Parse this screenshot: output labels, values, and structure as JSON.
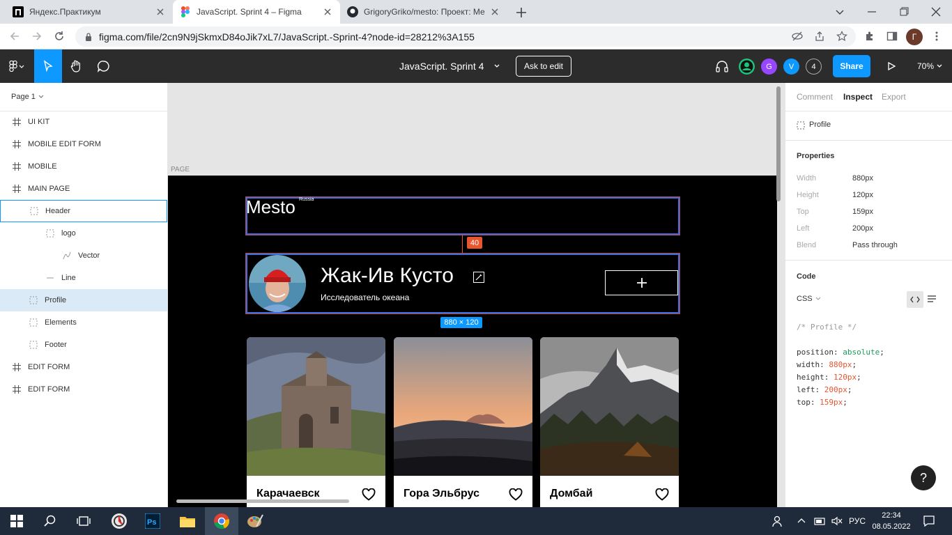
{
  "browser": {
    "tabs": [
      {
        "title": "Яндекс.Практикум",
        "active": false
      },
      {
        "title": "JavaScript. Sprint 4 – Figma",
        "active": true
      },
      {
        "title": "GrigoryGriko/mesto: Проект: Ме",
        "active": false
      }
    ],
    "url": "figma.com/file/2cn9N9jSkmxD84oJik7xL7/JavaScript.-Sprint-4?node-id=28212%3A155",
    "profile_initial": "Г"
  },
  "toolbar": {
    "file_title": "JavaScript. Sprint 4",
    "ask_to_edit": "Ask to edit",
    "avatars": [
      {
        "label": "",
        "color": "#1bc47d"
      },
      {
        "label": "G",
        "color": "#9747ff"
      },
      {
        "label": "V",
        "color": "#0d99ff"
      }
    ],
    "viewer_count": "4",
    "share": "Share",
    "zoom": "70%"
  },
  "layers": {
    "page": "Page 1",
    "items": [
      {
        "name": "UI KIT",
        "icon": "frame-icon",
        "indent": 0
      },
      {
        "name": "MOBILE EDIT FORM",
        "icon": "frame-icon",
        "indent": 0
      },
      {
        "name": "MOBILE",
        "icon": "frame-icon",
        "indent": 0
      },
      {
        "name": "MAIN PAGE",
        "icon": "frame-icon",
        "indent": 0
      },
      {
        "name": "Header",
        "icon": "group-icon",
        "indent": 1,
        "state": "hover"
      },
      {
        "name": "logo",
        "icon": "group-icon",
        "indent": 2
      },
      {
        "name": "Vector",
        "icon": "vector-icon",
        "indent": 3
      },
      {
        "name": "Line",
        "icon": "line-icon",
        "indent": 2
      },
      {
        "name": "Profile",
        "icon": "group-icon",
        "indent": 1,
        "state": "selected"
      },
      {
        "name": "Elements",
        "icon": "group-icon",
        "indent": 1
      },
      {
        "name": "Footer",
        "icon": "group-icon",
        "indent": 1
      },
      {
        "name": "EDIT FORM",
        "icon": "frame-icon",
        "indent": 0
      },
      {
        "name": "EDIT FORM",
        "icon": "frame-icon",
        "indent": 0
      }
    ]
  },
  "canvas": {
    "page_label": "PAGE",
    "logo": "Mesto",
    "logo_sub": "Russia",
    "spacing_badge": "40",
    "profile_name": "Жак-Ив Кусто",
    "profile_about": "Исследователь океана",
    "size_badge": "880 × 120",
    "cards": [
      {
        "title": "Карачаевск"
      },
      {
        "title": "Гора Эльбрус"
      },
      {
        "title": "Домбай"
      }
    ]
  },
  "inspect": {
    "tabs": [
      "Comment",
      "Inspect",
      "Export"
    ],
    "active_tab": "Inspect",
    "layer_name": "Profile",
    "properties_title": "Properties",
    "properties": [
      {
        "key": "Width",
        "value": "880px"
      },
      {
        "key": "Height",
        "value": "120px"
      },
      {
        "key": "Top",
        "value": "159px"
      },
      {
        "key": "Left",
        "value": "200px"
      },
      {
        "key": "Blend",
        "value": "Pass through"
      }
    ],
    "code_title": "Code",
    "code_lang": "CSS",
    "code_comment": "/* Profile */",
    "code_lines": [
      {
        "prop": "position",
        "val": "absolute"
      },
      {
        "prop": "width",
        "val": "880px"
      },
      {
        "prop": "height",
        "val": "120px"
      },
      {
        "prop": "left",
        "val": "200px"
      },
      {
        "prop": "top",
        "val": "159px"
      }
    ],
    "help": "?"
  },
  "taskbar": {
    "lang": "РУС",
    "time": "22:34",
    "date": "08.05.2022"
  }
}
